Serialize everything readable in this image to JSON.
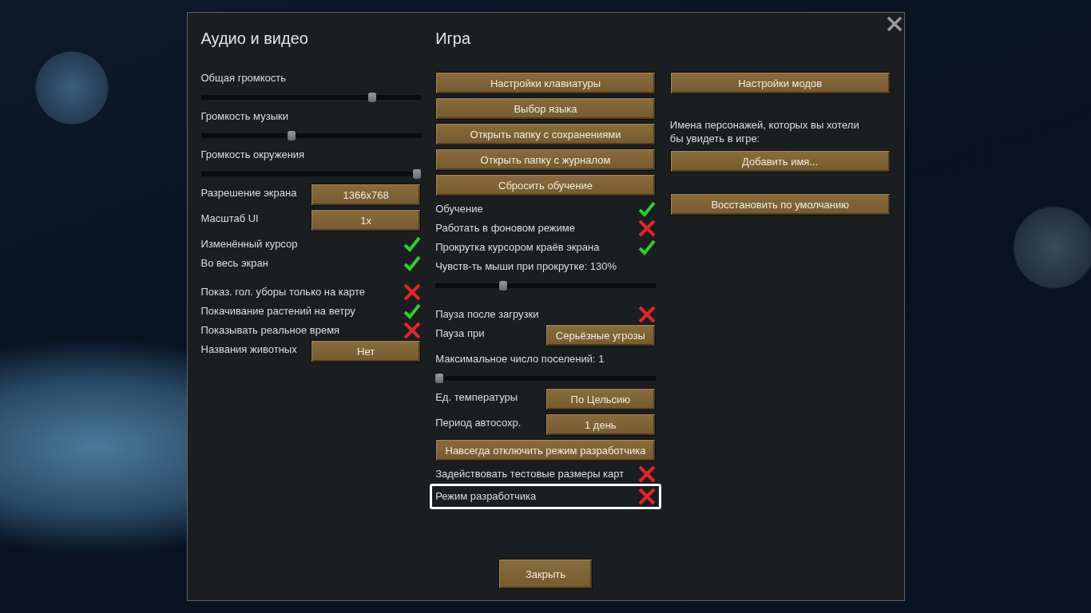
{
  "dialog": {
    "columns": [
      {
        "title": "Аудио и видео",
        "groups": [
          {
            "items": [
              {
                "kind": "slider",
                "label": "Общая громкость",
                "level": 0.79
              },
              {
                "kind": "slider",
                "label": "Громкость музыки",
                "level": 0.41
              },
              {
                "kind": "slider",
                "label": "Громкость окружения",
                "level": 1
              },
              {
                "kind": "dropdown",
                "label": "Разрешение экрана",
                "value": "1366x768"
              },
              {
                "kind": "dropdown",
                "label": "Масштаб UI",
                "value": "1x"
              },
              {
                "kind": "checkbox",
                "label": "Изменённый курсор",
                "checked": true,
                "highlighted": false
              },
              {
                "kind": "checkbox",
                "label": "Во весь экран",
                "checked": true,
                "highlighted": false
              }
            ]
          },
          {
            "items": [
              {
                "kind": "checkbox",
                "label": "Показ. гол. уборы только на карте",
                "checked": false,
                "highlighted": false
              },
              {
                "kind": "checkbox",
                "label": "Покачивание растений на ветру",
                "checked": true,
                "highlighted": false
              },
              {
                "kind": "checkbox",
                "label": "Показывать реальное время",
                "checked": false,
                "highlighted": false
              },
              {
                "kind": "dropdown",
                "label": "Названия животных",
                "value": "Нет"
              }
            ]
          }
        ]
      },
      {
        "title": "Игра",
        "groups": [
          {
            "items": [
              {
                "kind": "button",
                "label": "Настройки клавиатуры"
              },
              {
                "kind": "button",
                "label": "Выбор языка"
              },
              {
                "kind": "button",
                "label": "Открыть папку с сохранениями"
              },
              {
                "kind": "button",
                "label": "Открыть папку с журналом"
              },
              {
                "kind": "button",
                "label": "Сбросить обучение"
              },
              {
                "kind": "checkbox",
                "label": "Обучение",
                "checked": true,
                "highlighted": false
              },
              {
                "kind": "checkbox",
                "label": "Работать в фоновом режиме",
                "checked": false,
                "highlighted": false
              },
              {
                "kind": "checkbox",
                "label": "Прокрутка курсором краёв экрана",
                "checked": true,
                "highlighted": false
              },
              {
                "kind": "slider",
                "label": "Чувств-ть мыши при прокрутке: 130%",
                "level": 0.3
              }
            ]
          },
          {
            "items": [
              {
                "kind": "checkbox",
                "label": "Пауза после загрузки",
                "checked": false,
                "highlighted": false
              },
              {
                "kind": "dropdown",
                "label": "Пауза при",
                "value": "Серьёзные угрозы"
              },
              {
                "kind": "slider",
                "label": "Максимальное число поселений: 1",
                "level": 0
              },
              {
                "kind": "dropdown",
                "label": "Ед. температуры",
                "value": "По Цельсию"
              },
              {
                "kind": "dropdown",
                "label": "Период автосохр.",
                "value": "1 день"
              },
              {
                "kind": "button",
                "label": "Навсегда отключить режим разработчика"
              },
              {
                "kind": "checkbox",
                "label": "Задействовать тестовые размеры карт",
                "checked": false,
                "highlighted": false
              },
              {
                "kind": "checkbox",
                "label": "Режим разработчика",
                "checked": false,
                "highlighted": true
              }
            ]
          }
        ]
      },
      {
        "groups": [
          {
            "items": [
              {
                "kind": "button",
                "label": "Настройки модов"
              }
            ]
          },
          {
            "items": [
              {
                "kind": "text",
                "text": "Имена персонажей, которых вы хотели бы увидеть в игре:"
              },
              {
                "kind": "button",
                "label": "Добавить имя..."
              }
            ]
          },
          {
            "items": [
              {
                "kind": "button",
                "label": "Восстановить по умолчанию"
              }
            ]
          }
        ]
      }
    ],
    "close_button": "Закрыть"
  }
}
